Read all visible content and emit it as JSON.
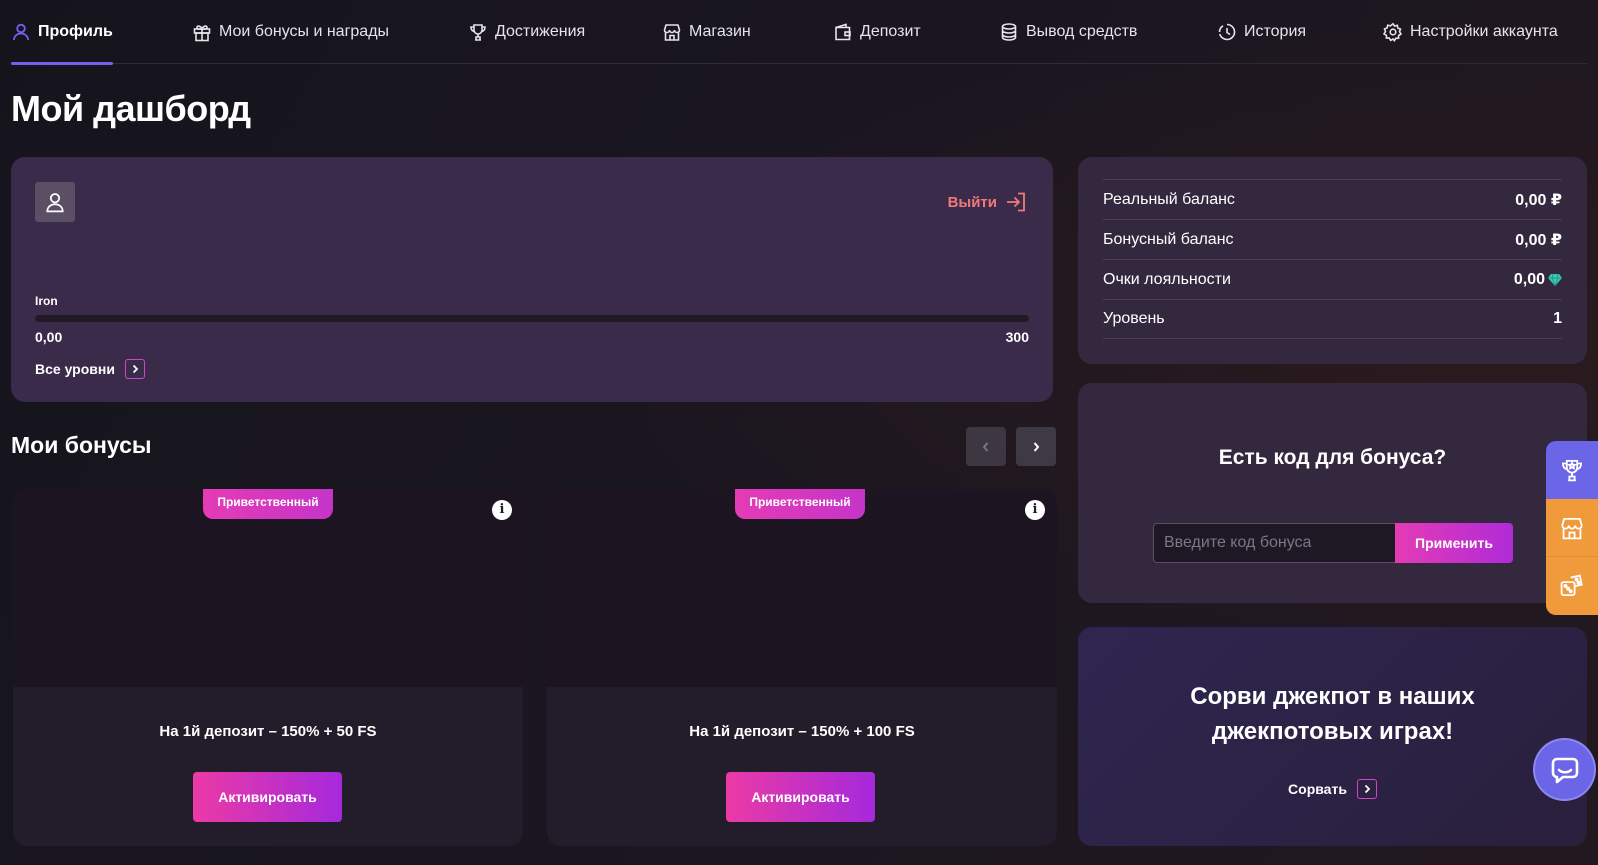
{
  "nav": {
    "items": [
      {
        "label": "Профиль",
        "icon": "user-icon"
      },
      {
        "label": "Мои бонусы и награды",
        "icon": "gift-icon"
      },
      {
        "label": "Достижения",
        "icon": "trophy-icon"
      },
      {
        "label": "Магазин",
        "icon": "store-icon"
      },
      {
        "label": "Депозит",
        "icon": "wallet-icon"
      },
      {
        "label": "Вывод средств",
        "icon": "coins-icon"
      },
      {
        "label": "История",
        "icon": "history-icon"
      },
      {
        "label": "Настройки аккаунта",
        "icon": "gear-icon"
      }
    ],
    "active_index": 0
  },
  "page_title": "Мой дашборд",
  "profile": {
    "logout_label": "Выйти",
    "level_name": "Iron",
    "progress_min": "0,00",
    "progress_max": "300",
    "progress_fraction": 0,
    "all_levels_label": "Все уровни"
  },
  "balances": [
    {
      "label": "Реальный баланс",
      "value": "0,00 ₽"
    },
    {
      "label": "Бонусный баланс",
      "value": "0,00 ₽"
    },
    {
      "label": "Очки лояльности",
      "value": "0,00",
      "icon": "gem-icon"
    },
    {
      "label": "Уровень",
      "value": "1"
    }
  ],
  "bonus_code": {
    "title": "Есть код для бонуса?",
    "placeholder": "Введите код бонуса",
    "apply_label": "Применить"
  },
  "jackpot": {
    "title": "Сорви джекпот в наших джекпотовых играх!",
    "link_label": "Сорвать"
  },
  "bonuses": {
    "title": "Мои бонусы",
    "cards": [
      {
        "tag": "Приветственный",
        "name": "На 1й депозит – 150% + 50 FS",
        "button": "Активировать"
      },
      {
        "tag": "Приветственный",
        "name": "На 1й депозит – 150% + 100 FS",
        "button": "Активировать"
      }
    ]
  },
  "colors": {
    "accent": "#7b5cf0",
    "pink": "#e53bb5",
    "orange": "#f09a3c",
    "logout": "#f07a7a",
    "gem": "#38c9b4"
  }
}
